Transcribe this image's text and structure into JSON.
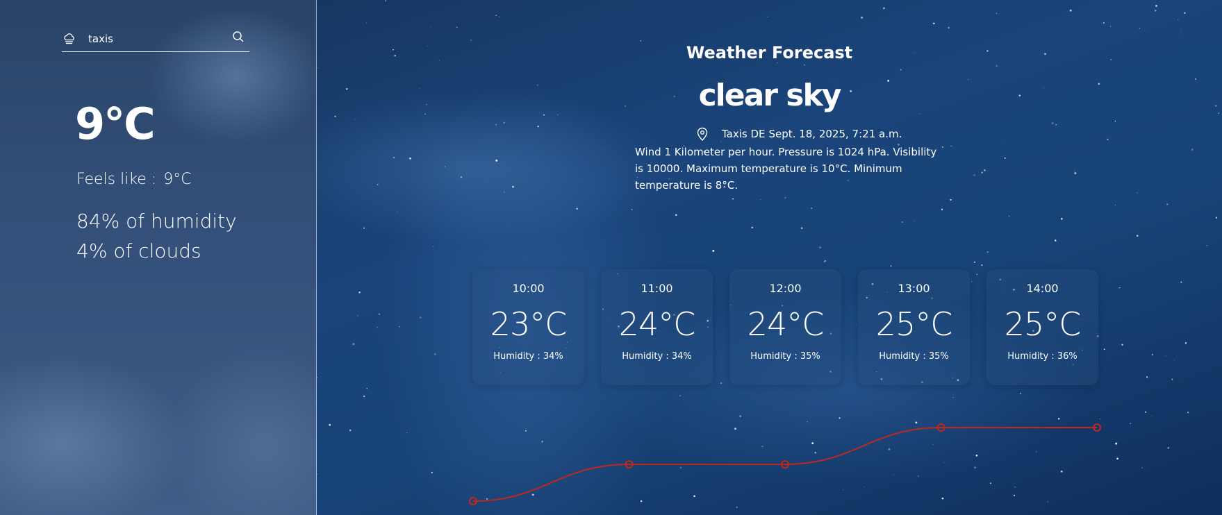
{
  "search": {
    "value": "taxis",
    "icon": "cloud-icon",
    "button_icon": "search-icon"
  },
  "current": {
    "temp": "9°C",
    "feels_label": "Feels like :",
    "feels_value": "9°C",
    "humidity": "84% of humidity",
    "clouds": "4% of clouds"
  },
  "header": {
    "title": "Weather Forecast",
    "condition": "clear sky",
    "location": "Taxis DE",
    "datetime": "Sept. 18, 2025, 7:21 a.m.",
    "description": "Wind 1 Kilometer per hour. Pressure is 1024 hPa. Visibility is 10000. Maximum temperature is 10°C. Minimum temperature is 8°C."
  },
  "hourly": [
    {
      "time": "10:00",
      "temp": "23°C",
      "humidity": "Humidity : 34%"
    },
    {
      "time": "11:00",
      "temp": "24°C",
      "humidity": "Humidity : 34%"
    },
    {
      "time": "12:00",
      "temp": "24°C",
      "humidity": "Humidity : 35%"
    },
    {
      "time": "13:00",
      "temp": "25°C",
      "humidity": "Humidity : 35%"
    },
    {
      "time": "14:00",
      "temp": "25°C",
      "humidity": "Humidity : 36%"
    }
  ],
  "chart_data": {
    "type": "line",
    "x": [
      "10:00",
      "11:00",
      "12:00",
      "13:00",
      "14:00"
    ],
    "series": [
      {
        "values": [
          23,
          24,
          24,
          25,
          25
        ]
      }
    ],
    "color": "#c0281e"
  },
  "colors": {
    "line": "#c0281e",
    "text": "#ffffff"
  }
}
